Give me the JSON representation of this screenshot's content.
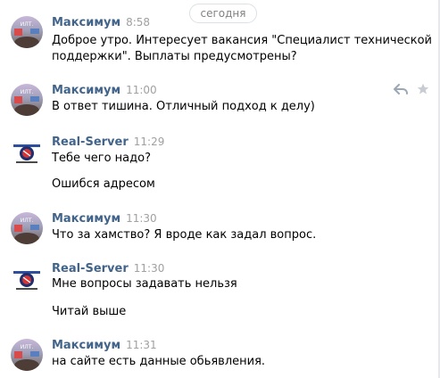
{
  "date_divider": "сегодня",
  "messages": [
    {
      "author": "Максимум",
      "time": "8:58",
      "avatar": "maksimum",
      "lines": [
        "Доброе утро. Интересует вакансия \"Специалист технической",
        "поддержки\". Выплаты предусмотрены?"
      ]
    },
    {
      "author": "Максимум",
      "time": "11:00",
      "avatar": "maksimum",
      "lines": [
        "В ответ тишина. Отличный подход к делу)"
      ]
    },
    {
      "author": "Real-Server",
      "time": "11:29",
      "avatar": "realserver",
      "lines": [
        "Тебе чего надо?",
        "Ошибся адресом"
      ]
    },
    {
      "author": "Максимум",
      "time": "11:30",
      "avatar": "maksimum",
      "lines": [
        "Что за хамство? Я вроде как задал вопрос."
      ]
    },
    {
      "author": "Real-Server",
      "time": "11:30",
      "avatar": "realserver",
      "lines": [
        "Мне вопросы задавать нельзя",
        "Читай выше"
      ]
    },
    {
      "author": "Максимум",
      "time": "11:31",
      "avatar": "maksimum",
      "lines": [
        "на сайте есть данные обьявления."
      ]
    }
  ],
  "colors": {
    "author": "#42648b",
    "time": "#a0a0a0",
    "pill_border": "#dce1e6",
    "pill_text": "#828282"
  },
  "icons": [
    "reply-icon",
    "star-icon"
  ]
}
